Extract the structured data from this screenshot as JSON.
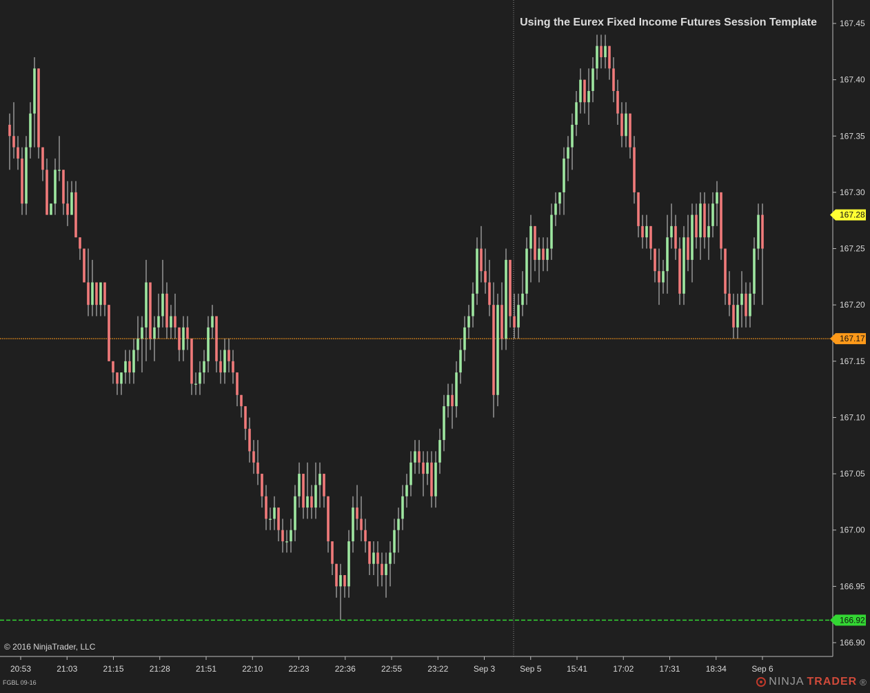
{
  "annotation": "Using the Eurex Fixed Income Futures Session Template",
  "copyright": "© 2016 NinjaTrader, LLC",
  "instrument": "FGBL 09-16",
  "brand": {
    "part1": "NINJA",
    "part2": "TRADER",
    "mark": "®"
  },
  "colors": {
    "background": "#1f1f1f",
    "up": "#9ee6a0",
    "down": "#f07a7a",
    "wick": "#d0d0d0",
    "axis_text": "#d9d9d9",
    "last_price_marker": "#ffff33",
    "horizontal_line": "#ff9a1a",
    "stop_line": "#33d633",
    "session_break": "#888888"
  },
  "chart_data": {
    "type": "candlestick",
    "ylim": [
      166.9,
      167.45
    ],
    "y_ticks": [
      "166.90",
      "166.95",
      "167.00",
      "167.05",
      "167.10",
      "167.15",
      "167.20",
      "167.25",
      "167.30",
      "167.35",
      "167.40",
      "167.45"
    ],
    "x_ticks": [
      "20:53",
      "21:03",
      "21:15",
      "21:28",
      "21:51",
      "22:10",
      "22:23",
      "22:36",
      "22:55",
      "23:22",
      "Sep 3",
      "Sep 5",
      "15:41",
      "17:02",
      "17:31",
      "18:34",
      "Sep 6"
    ],
    "price_markers": [
      {
        "label": "167.28",
        "value": 167.28,
        "kind": "last_price"
      },
      {
        "label": "167.17",
        "value": 167.17,
        "kind": "horizontal_line"
      },
      {
        "label": "166.92",
        "value": 166.92,
        "kind": "stop_line"
      }
    ],
    "candles": [
      [
        167.36,
        167.37,
        167.32,
        167.35
      ],
      [
        167.35,
        167.38,
        167.33,
        167.34
      ],
      [
        167.34,
        167.35,
        167.32,
        167.33
      ],
      [
        167.33,
        167.34,
        167.28,
        167.29
      ],
      [
        167.29,
        167.35,
        167.28,
        167.34
      ],
      [
        167.34,
        167.38,
        167.33,
        167.37
      ],
      [
        167.37,
        167.42,
        167.34,
        167.41
      ],
      [
        167.41,
        167.41,
        167.33,
        167.34
      ],
      [
        167.34,
        167.34,
        167.31,
        167.32
      ],
      [
        167.32,
        167.33,
        167.28,
        167.28
      ],
      [
        167.28,
        167.29,
        167.28,
        167.29
      ],
      [
        167.29,
        167.33,
        167.28,
        167.32
      ],
      [
        167.32,
        167.35,
        167.31,
        167.32
      ],
      [
        167.32,
        167.32,
        167.28,
        167.29
      ],
      [
        167.29,
        167.31,
        167.27,
        167.28
      ],
      [
        167.28,
        167.31,
        167.28,
        167.3
      ],
      [
        167.3,
        167.31,
        167.26,
        167.26
      ],
      [
        167.26,
        167.26,
        167.24,
        167.25
      ],
      [
        167.25,
        167.25,
        167.22,
        167.22
      ],
      [
        167.22,
        167.25,
        167.19,
        167.2
      ],
      [
        167.2,
        167.24,
        167.19,
        167.22
      ],
      [
        167.22,
        167.22,
        167.19,
        167.2
      ],
      [
        167.2,
        167.22,
        167.19,
        167.22
      ],
      [
        167.22,
        167.22,
        167.19,
        167.2
      ],
      [
        167.2,
        167.2,
        167.15,
        167.15
      ],
      [
        167.15,
        167.15,
        167.13,
        167.14
      ],
      [
        167.14,
        167.14,
        167.12,
        167.13
      ],
      [
        167.13,
        167.14,
        167.12,
        167.14
      ],
      [
        167.14,
        167.16,
        167.13,
        167.15
      ],
      [
        167.15,
        167.16,
        167.13,
        167.14
      ],
      [
        167.14,
        167.17,
        167.13,
        167.16
      ],
      [
        167.16,
        167.19,
        167.15,
        167.17
      ],
      [
        167.17,
        167.19,
        167.14,
        167.18
      ],
      [
        167.18,
        167.24,
        167.15,
        167.22
      ],
      [
        167.22,
        167.22,
        167.16,
        167.17
      ],
      [
        167.17,
        167.19,
        167.15,
        167.18
      ],
      [
        167.18,
        167.21,
        167.17,
        167.19
      ],
      [
        167.19,
        167.24,
        167.18,
        167.21
      ],
      [
        167.21,
        167.22,
        167.17,
        167.18
      ],
      [
        167.18,
        167.2,
        167.17,
        167.19
      ],
      [
        167.19,
        167.21,
        167.17,
        167.18
      ],
      [
        167.18,
        167.18,
        167.15,
        167.16
      ],
      [
        167.16,
        167.19,
        167.15,
        167.18
      ],
      [
        167.18,
        167.19,
        167.16,
        167.17
      ],
      [
        167.17,
        167.17,
        167.12,
        167.13
      ],
      [
        167.13,
        167.14,
        167.12,
        167.13
      ],
      [
        167.13,
        167.15,
        167.12,
        167.14
      ],
      [
        167.14,
        167.16,
        167.13,
        167.15
      ],
      [
        167.15,
        167.19,
        167.14,
        167.18
      ],
      [
        167.18,
        167.2,
        167.17,
        167.19
      ],
      [
        167.19,
        167.19,
        167.14,
        167.15
      ],
      [
        167.15,
        167.16,
        167.13,
        167.14
      ],
      [
        167.14,
        167.17,
        167.13,
        167.16
      ],
      [
        167.16,
        167.17,
        167.14,
        167.15
      ],
      [
        167.15,
        167.16,
        167.13,
        167.14
      ],
      [
        167.14,
        167.14,
        167.11,
        167.12
      ],
      [
        167.12,
        167.12,
        167.1,
        167.11
      ],
      [
        167.11,
        167.11,
        167.08,
        167.09
      ],
      [
        167.09,
        167.1,
        167.06,
        167.07
      ],
      [
        167.07,
        167.08,
        167.05,
        167.06
      ],
      [
        167.06,
        167.08,
        167.04,
        167.05
      ],
      [
        167.05,
        167.05,
        167.02,
        167.03
      ],
      [
        167.03,
        167.04,
        167.0,
        167.01
      ],
      [
        167.01,
        167.02,
        167.0,
        167.01
      ],
      [
        167.01,
        167.03,
        167.0,
        167.02
      ],
      [
        167.02,
        167.02,
        166.99,
        167.0
      ],
      [
        167.0,
        167.01,
        166.98,
        166.99
      ],
      [
        166.99,
        167.0,
        166.98,
        166.99
      ],
      [
        166.99,
        167.01,
        166.98,
        167.0
      ],
      [
        167.0,
        167.04,
        166.99,
        167.03
      ],
      [
        167.03,
        167.06,
        167.02,
        167.05
      ],
      [
        167.05,
        167.05,
        167.01,
        167.02
      ],
      [
        167.02,
        167.06,
        167.01,
        167.03
      ],
      [
        167.03,
        167.04,
        167.01,
        167.02
      ],
      [
        167.02,
        167.06,
        167.01,
        167.04
      ],
      [
        167.04,
        167.06,
        167.02,
        167.05
      ],
      [
        167.05,
        167.05,
        167.02,
        167.03
      ],
      [
        167.03,
        167.03,
        166.98,
        166.99
      ],
      [
        166.99,
        166.99,
        166.96,
        166.97
      ],
      [
        166.97,
        166.97,
        166.94,
        166.95
      ],
      [
        166.95,
        166.97,
        166.92,
        166.96
      ],
      [
        166.96,
        166.96,
        166.94,
        166.95
      ],
      [
        166.95,
        167.0,
        166.94,
        166.99
      ],
      [
        166.99,
        167.03,
        166.98,
        167.02
      ],
      [
        167.02,
        167.04,
        167.0,
        167.01
      ],
      [
        167.01,
        167.03,
        166.99,
        167.0
      ],
      [
        167.0,
        167.01,
        166.98,
        166.99
      ],
      [
        166.99,
        166.99,
        166.96,
        166.97
      ],
      [
        166.97,
        166.99,
        166.96,
        166.98
      ],
      [
        166.98,
        166.99,
        166.95,
        166.97
      ],
      [
        166.97,
        166.98,
        166.95,
        166.96
      ],
      [
        166.96,
        166.98,
        166.94,
        166.97
      ],
      [
        166.97,
        166.99,
        166.95,
        166.98
      ],
      [
        166.98,
        167.01,
        166.97,
        167.0
      ],
      [
        167.0,
        167.02,
        166.98,
        167.01
      ],
      [
        167.01,
        167.04,
        167.0,
        167.03
      ],
      [
        167.03,
        167.05,
        167.02,
        167.04
      ],
      [
        167.04,
        167.07,
        167.03,
        167.06
      ],
      [
        167.06,
        167.08,
        167.05,
        167.07
      ],
      [
        167.07,
        167.08,
        167.05,
        167.06
      ],
      [
        167.06,
        167.07,
        167.03,
        167.05
      ],
      [
        167.05,
        167.07,
        167.04,
        167.06
      ],
      [
        167.06,
        167.07,
        167.02,
        167.03
      ],
      [
        167.03,
        167.07,
        167.02,
        167.06
      ],
      [
        167.06,
        167.09,
        167.05,
        167.08
      ],
      [
        167.08,
        167.12,
        167.07,
        167.11
      ],
      [
        167.11,
        167.13,
        167.1,
        167.12
      ],
      [
        167.12,
        167.13,
        167.09,
        167.11
      ],
      [
        167.11,
        167.15,
        167.1,
        167.14
      ],
      [
        167.14,
        167.17,
        167.13,
        167.16
      ],
      [
        167.16,
        167.19,
        167.15,
        167.18
      ],
      [
        167.18,
        167.2,
        167.17,
        167.19
      ],
      [
        167.19,
        167.22,
        167.18,
        167.21
      ],
      [
        167.21,
        167.26,
        167.2,
        167.25
      ],
      [
        167.25,
        167.27,
        167.22,
        167.23
      ],
      [
        167.23,
        167.25,
        167.21,
        167.22
      ],
      [
        167.22,
        167.24,
        167.19,
        167.2
      ],
      [
        167.2,
        167.22,
        167.1,
        167.12
      ],
      [
        167.12,
        167.21,
        167.11,
        167.2
      ],
      [
        167.2,
        167.22,
        167.16,
        167.17
      ],
      [
        167.17,
        167.25,
        167.16,
        167.24
      ],
      [
        167.24,
        167.24,
        167.18,
        167.19
      ],
      [
        167.19,
        167.21,
        167.17,
        167.18
      ],
      [
        167.18,
        167.21,
        167.17,
        167.2
      ],
      [
        167.2,
        167.23,
        167.19,
        167.21
      ],
      [
        167.21,
        167.26,
        167.2,
        167.25
      ],
      [
        167.25,
        167.28,
        167.22,
        167.27
      ],
      [
        167.27,
        167.27,
        167.23,
        167.24
      ],
      [
        167.24,
        167.26,
        167.22,
        167.25
      ],
      [
        167.25,
        167.26,
        167.23,
        167.24
      ],
      [
        167.24,
        167.26,
        167.23,
        167.25
      ],
      [
        167.25,
        167.29,
        167.24,
        167.28
      ],
      [
        167.28,
        167.3,
        167.27,
        167.29
      ],
      [
        167.29,
        167.3,
        167.28,
        167.3
      ],
      [
        167.3,
        167.34,
        167.28,
        167.33
      ],
      [
        167.33,
        167.35,
        167.31,
        167.34
      ],
      [
        167.34,
        167.37,
        167.32,
        167.36
      ],
      [
        167.36,
        167.39,
        167.35,
        167.38
      ],
      [
        167.38,
        167.41,
        167.37,
        167.4
      ],
      [
        167.4,
        167.4,
        167.37,
        167.38
      ],
      [
        167.38,
        167.41,
        167.36,
        167.39
      ],
      [
        167.39,
        167.42,
        167.38,
        167.41
      ],
      [
        167.41,
        167.44,
        167.4,
        167.43
      ],
      [
        167.43,
        167.44,
        167.41,
        167.42
      ],
      [
        167.42,
        167.44,
        167.41,
        167.43
      ],
      [
        167.43,
        167.43,
        167.4,
        167.41
      ],
      [
        167.41,
        167.42,
        167.38,
        167.39
      ],
      [
        167.39,
        167.4,
        167.36,
        167.37
      ],
      [
        167.37,
        167.38,
        167.34,
        167.35
      ],
      [
        167.35,
        167.38,
        167.34,
        167.37
      ],
      [
        167.37,
        167.37,
        167.33,
        167.34
      ],
      [
        167.34,
        167.35,
        167.29,
        167.3
      ],
      [
        167.3,
        167.3,
        167.26,
        167.27
      ],
      [
        167.27,
        167.28,
        167.25,
        167.26
      ],
      [
        167.26,
        167.28,
        167.25,
        167.27
      ],
      [
        167.27,
        167.27,
        167.24,
        167.25
      ],
      [
        167.25,
        167.25,
        167.22,
        167.23
      ],
      [
        167.23,
        167.25,
        167.2,
        167.22
      ],
      [
        167.22,
        167.24,
        167.21,
        167.23
      ],
      [
        167.23,
        167.28,
        167.21,
        167.26
      ],
      [
        167.26,
        167.29,
        167.25,
        167.27
      ],
      [
        167.27,
        167.28,
        167.24,
        167.25
      ],
      [
        167.25,
        167.26,
        167.2,
        167.21
      ],
      [
        167.21,
        167.27,
        167.2,
        167.26
      ],
      [
        167.26,
        167.28,
        167.23,
        167.24
      ],
      [
        167.24,
        167.29,
        167.22,
        167.28
      ],
      [
        167.28,
        167.29,
        167.25,
        167.26
      ],
      [
        167.26,
        167.3,
        167.24,
        167.29
      ],
      [
        167.29,
        167.3,
        167.25,
        167.26
      ],
      [
        167.26,
        167.29,
        167.24,
        167.27
      ],
      [
        167.27,
        167.3,
        167.26,
        167.29
      ],
      [
        167.29,
        167.31,
        167.27,
        167.3
      ],
      [
        167.3,
        167.3,
        167.24,
        167.25
      ],
      [
        167.25,
        167.25,
        167.2,
        167.21
      ],
      [
        167.21,
        167.23,
        167.19,
        167.2
      ],
      [
        167.2,
        167.21,
        167.17,
        167.18
      ],
      [
        167.18,
        167.21,
        167.17,
        167.2
      ],
      [
        167.2,
        167.23,
        167.18,
        167.21
      ],
      [
        167.21,
        167.22,
        167.18,
        167.19
      ],
      [
        167.19,
        167.22,
        167.18,
        167.21
      ],
      [
        167.21,
        167.26,
        167.2,
        167.25
      ],
      [
        167.25,
        167.29,
        167.24,
        167.28
      ],
      [
        167.28,
        167.29,
        167.2,
        167.25
      ]
    ]
  }
}
